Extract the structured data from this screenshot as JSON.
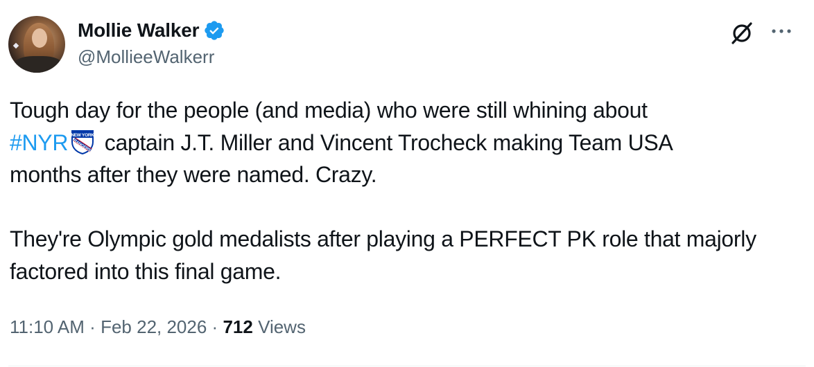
{
  "author": {
    "display_name": "Mollie Walker",
    "handle": "@MollieeWalkerr",
    "verified": true,
    "verified_color": "#1d9bf0"
  },
  "tweet": {
    "line1": "Tough day for the people (and media) who were still whining about",
    "hashtag": "#NYR",
    "hashtag_emoji": "new-york-rangers-logo",
    "line2_rest": "captain J.T. Miller and Vincent Trocheck making Team USA",
    "line3": "months after they were named. Crazy.",
    "para2": "They're Olympic gold medalists after playing a PERFECT  PK role that majorly factored into this final game."
  },
  "meta": {
    "time": "11:10 AM",
    "separator": "·",
    "date": "Feb 22, 2026",
    "views_count": "712",
    "views_label": "Views"
  },
  "icons": {
    "grok": "grok-icon",
    "more": "more-options-icon",
    "verified": "verified-badge-icon"
  },
  "colors": {
    "text": "#0f1419",
    "secondary": "#536471",
    "link": "#1d9bf0"
  }
}
